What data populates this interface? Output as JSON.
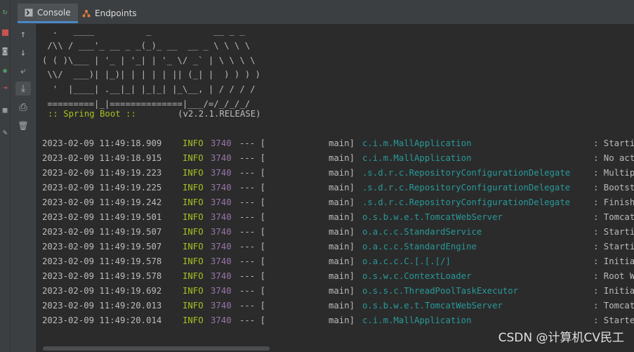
{
  "tabs": [
    {
      "label": "Console",
      "icon": "console-icon",
      "active": true
    },
    {
      "label": "Endpoints",
      "icon": "endpoints-icon",
      "active": false
    }
  ],
  "banner_lines": [
    "  .   ____          _            __ _ _",
    " /\\\\ / ___'_ __ _ _(_)_ __  __ _ \\ \\ \\ \\",
    "( ( )\\___ | '_ | '_| | '_ \\/ _` | \\ \\ \\ \\",
    " \\\\/  ___)| |_)| | | | | || (_| |  ) ) ) )",
    "  '  |____| .__|_| |_|_| |_\\__, | / / / /",
    " =========|_|==============|___/=/_/_/_/"
  ],
  "spring_boot": {
    "label": ":: Spring Boot ::",
    "version": "(v2.2.1.RELEASE)"
  },
  "logs": [
    {
      "ts": "2023-02-09 11:49:18.909",
      "level": "INFO",
      "pid": "3740",
      "sep": "--- [",
      "thread": "main]",
      "logger": "c.i.m.MallApplication",
      "msg": ": Startin"
    },
    {
      "ts": "2023-02-09 11:49:18.915",
      "level": "INFO",
      "pid": "3740",
      "sep": "--- [",
      "thread": "main]",
      "logger": "c.i.m.MallApplication",
      "msg": ": No act"
    },
    {
      "ts": "2023-02-09 11:49:19.223",
      "level": "INFO",
      "pid": "3740",
      "sep": "--- [",
      "thread": "main]",
      "logger": ".s.d.r.c.RepositoryConfigurationDelegate",
      "msg": ": Multip"
    },
    {
      "ts": "2023-02-09 11:49:19.225",
      "level": "INFO",
      "pid": "3740",
      "sep": "--- [",
      "thread": "main]",
      "logger": ".s.d.r.c.RepositoryConfigurationDelegate",
      "msg": ": Bootst"
    },
    {
      "ts": "2023-02-09 11:49:19.242",
      "level": "INFO",
      "pid": "3740",
      "sep": "--- [",
      "thread": "main]",
      "logger": ".s.d.r.c.RepositoryConfigurationDelegate",
      "msg": ": Finish"
    },
    {
      "ts": "2023-02-09 11:49:19.501",
      "level": "INFO",
      "pid": "3740",
      "sep": "--- [",
      "thread": "main]",
      "logger": "o.s.b.w.e.t.TomcatWebServer",
      "msg": ": Tomcat"
    },
    {
      "ts": "2023-02-09 11:49:19.507",
      "level": "INFO",
      "pid": "3740",
      "sep": "--- [",
      "thread": "main]",
      "logger": "o.a.c.c.StandardService",
      "msg": ": Starti"
    },
    {
      "ts": "2023-02-09 11:49:19.507",
      "level": "INFO",
      "pid": "3740",
      "sep": "--- [",
      "thread": "main]",
      "logger": "o.a.c.c.StandardEngine",
      "msg": ": Starti"
    },
    {
      "ts": "2023-02-09 11:49:19.578",
      "level": "INFO",
      "pid": "3740",
      "sep": "--- [",
      "thread": "main]",
      "logger": "o.a.c.c.C.[.[.[/]",
      "msg": ": Initia"
    },
    {
      "ts": "2023-02-09 11:49:19.578",
      "level": "INFO",
      "pid": "3740",
      "sep": "--- [",
      "thread": "main]",
      "logger": "o.s.w.c.ContextLoader",
      "msg": ": Root W"
    },
    {
      "ts": "2023-02-09 11:49:19.692",
      "level": "INFO",
      "pid": "3740",
      "sep": "--- [",
      "thread": "main]",
      "logger": "o.s.s.c.ThreadPoolTaskExecutor",
      "msg": ": Initia"
    },
    {
      "ts": "2023-02-09 11:49:20.013",
      "level": "INFO",
      "pid": "3740",
      "sep": "--- [",
      "thread": "main]",
      "logger": "o.s.b.w.e.t.TomcatWebServer",
      "msg": ": Tomcat"
    },
    {
      "ts": "2023-02-09 11:49:20.014",
      "level": "INFO",
      "pid": "3740",
      "sep": "--- [",
      "thread": "main]",
      "logger": "c.i.m.MallApplication",
      "msg": ": Starte"
    }
  ],
  "toolbar": {
    "up": "↑",
    "down": "↓",
    "wrap": "⤶",
    "scroll_end": "⤓",
    "print": "⎙",
    "trash": "🗑"
  },
  "watermark": "CSDN @计算机CV民工",
  "colors": {
    "info": "#a8c023",
    "pid": "#9876aa",
    "logger": "#299999",
    "accent": "#4a88c7"
  }
}
